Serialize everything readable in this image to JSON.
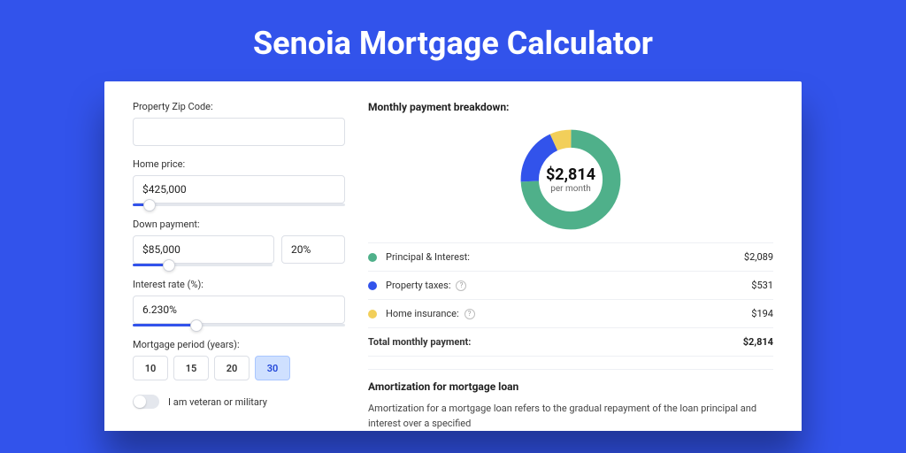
{
  "title": "Senoia Mortgage Calculator",
  "form": {
    "zip_label": "Property Zip Code:",
    "zip_value": "",
    "home_price_label": "Home price:",
    "home_price_value": "$425,000",
    "home_price_slider_pct": 8,
    "down_label": "Down payment:",
    "down_value": "$85,000",
    "down_pct_value": "20%",
    "down_slider_pct": 20,
    "rate_label": "Interest rate (%):",
    "rate_value": "6.230%",
    "rate_slider_pct": 30,
    "period_label": "Mortgage period (years):",
    "periods": [
      "10",
      "15",
      "20",
      "30"
    ],
    "period_selected": "30",
    "veteran_label": "I am veteran or military"
  },
  "breakdown": {
    "title": "Monthly payment breakdown:",
    "center_value": "$2,814",
    "center_sub": "per month",
    "items": [
      {
        "label": "Principal & Interest:",
        "value": "$2,089",
        "color": "#4fb08a",
        "has_info": false,
        "num": 2089
      },
      {
        "label": "Property taxes:",
        "value": "$531",
        "color": "#3253eb",
        "has_info": true,
        "num": 531
      },
      {
        "label": "Home insurance:",
        "value": "$194",
        "color": "#f2cf5a",
        "has_info": true,
        "num": 194
      }
    ],
    "total_label": "Total monthly payment:",
    "total_value": "$2,814"
  },
  "amort": {
    "title": "Amortization for mortgage loan",
    "body": "Amortization for a mortgage loan refers to the gradual repayment of the loan principal and interest over a specified"
  },
  "chart_data": {
    "type": "pie",
    "title": "Monthly payment breakdown",
    "categories": [
      "Principal & Interest",
      "Property taxes",
      "Home insurance"
    ],
    "values": [
      2089,
      531,
      194
    ],
    "colors": [
      "#4fb08a",
      "#3253eb",
      "#f2cf5a"
    ],
    "total": 2814
  }
}
